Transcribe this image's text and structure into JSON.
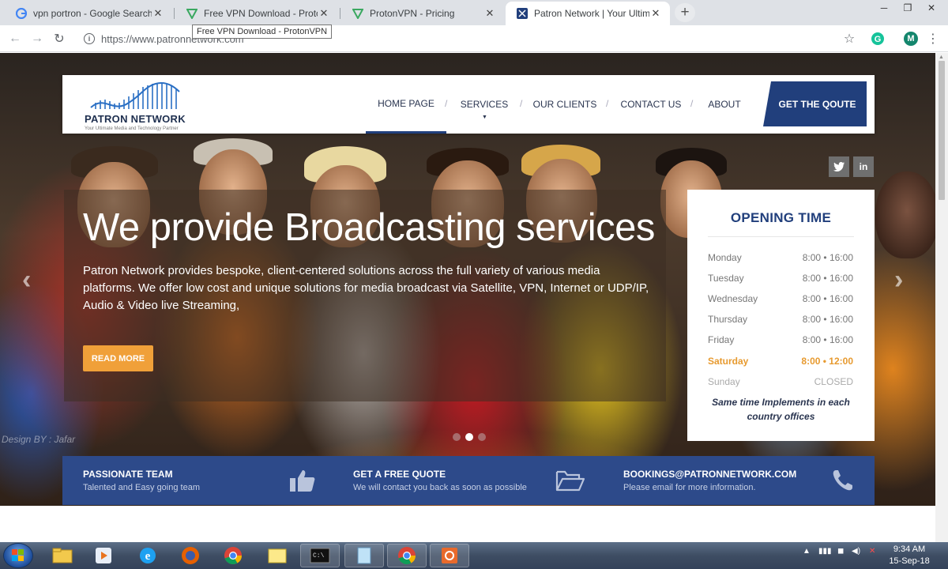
{
  "browser": {
    "tabs": [
      {
        "title": "vpn portron - Google Search",
        "active": false
      },
      {
        "title": "Free VPN Download - ProtonVPN",
        "active": false
      },
      {
        "title": "ProtonVPN - Pricing",
        "active": false
      },
      {
        "title": "Patron Network | Your Ultimate M",
        "active": true
      }
    ],
    "tooltip": "Free VPN Download - ProtonVPN",
    "url": "https://www.patronnetwork.com",
    "profile_initial": "M"
  },
  "site": {
    "logo_name": "PATRON NETWORK",
    "logo_tagline": "Your Ultimate Media and Technology Partner",
    "nav": [
      "HOME PAGE",
      "SERVICES",
      "OUR CLIENTS",
      "CONTACT US",
      "ABOUT"
    ],
    "quote_button": "GET THE QOUTE",
    "social": [
      "twitter",
      "linkedin"
    ],
    "hero": {
      "headline": "We provide Broadcasting services",
      "description": "Patron Network provides bespoke, client-centered solutions across the full variety of various media platforms. We offer low cost and unique solutions for media broadcast via Satellite, VPN, Internet or UDP/IP, Audio & Video live Streaming,",
      "button": "READ MORE",
      "credit": "Design BY : Jafar",
      "slide_count": 3,
      "active_slide": 1
    },
    "opening": {
      "title": "OPENING TIME",
      "days": [
        {
          "day": "Monday",
          "time": "8:00 • 16:00"
        },
        {
          "day": "Tuesday",
          "time": "8:00 • 16:00"
        },
        {
          "day": "Wednesday",
          "time": "8:00 • 16:00"
        },
        {
          "day": "Thursday",
          "time": "8:00 • 16:00"
        },
        {
          "day": "Friday",
          "time": "8:00 • 16:00"
        },
        {
          "day": "Saturday",
          "time": "8:00 • 12:00"
        },
        {
          "day": "Sunday",
          "time": "CLOSED"
        }
      ],
      "note": "Same time Implements in each country offices"
    },
    "infobar": [
      {
        "title": "PASSIONATE TEAM",
        "subtitle": "Talented and Easy going team",
        "icon": "thumbs-up-icon"
      },
      {
        "title": "GET A FREE QUOTE",
        "subtitle": "We will contact you back as soon as possible",
        "icon": "folder-open-icon"
      },
      {
        "title": "BOOKINGS@PATRONNETWORK.COM",
        "subtitle": "Please email for more information.",
        "icon": "phone-icon"
      }
    ]
  },
  "taskbar": {
    "time": "9:34 AM",
    "date": "15-Sep-18"
  },
  "colors": {
    "brand_navy": "#213f7c",
    "infobar_blue": "#2d4a8a",
    "accent_orange": "#f0a039"
  }
}
